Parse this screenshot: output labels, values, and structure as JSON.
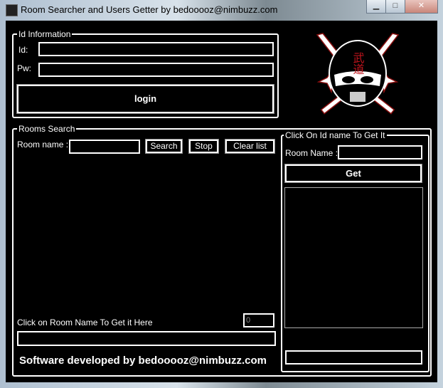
{
  "window": {
    "title": "Room Searcher and Users Getter by bedooooz@nimbuzz.com",
    "minimize": "▁",
    "maximize": "□",
    "close": "✕"
  },
  "id_info": {
    "legend": "Id Information",
    "id_label": "Id:",
    "pw_label": "Pw:",
    "id_value": "",
    "pw_value": "",
    "login": "login"
  },
  "rooms": {
    "legend": "Rooms Search",
    "room_name_label": "Room name :",
    "room_name_value": "",
    "search": "Search",
    "stop": "Stop",
    "clear": "Clear list",
    "hint": "Click on Room Name To Get it Here",
    "count": "0",
    "selected_room": "",
    "footer": "Software developed by bedooooz@nimbuzz.com"
  },
  "getter": {
    "legend": "Click On Id name To Get It",
    "room_name_label": "Room Name :",
    "room_name_value": "",
    "get": "Get",
    "result": ""
  },
  "logo": {
    "text": "武道",
    "colors": {
      "accent": "#c0141c"
    }
  }
}
